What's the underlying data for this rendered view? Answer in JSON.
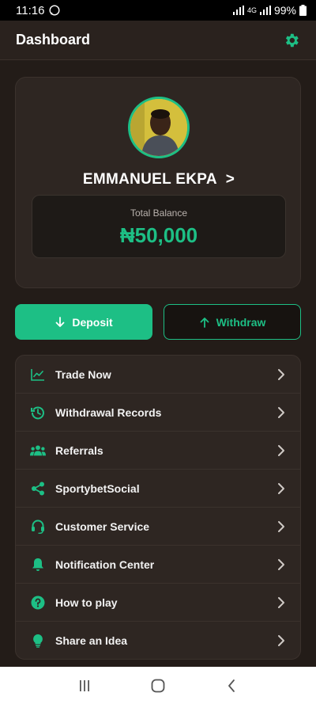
{
  "status_bar": {
    "time": "11:16",
    "network": "4G",
    "battery": "99%"
  },
  "header": {
    "title": "Dashboard"
  },
  "profile": {
    "name": "EMMANUEL EKPA",
    "arrow": ">",
    "balance_label": "Total Balance",
    "balance_amount": "₦50,000"
  },
  "actions": {
    "deposit_label": "Deposit",
    "withdraw_label": "Withdraw"
  },
  "menu": {
    "items": [
      {
        "label": "Trade Now",
        "icon": "chart-line-icon"
      },
      {
        "label": "Withdrawal Records",
        "icon": "history-icon"
      },
      {
        "label": "Referrals",
        "icon": "users-icon"
      },
      {
        "label": "SportybetSocial",
        "icon": "share-icon"
      },
      {
        "label": "Customer Service",
        "icon": "headset-icon"
      },
      {
        "label": "Notification Center",
        "icon": "bell-icon"
      },
      {
        "label": "How to play",
        "icon": "question-icon"
      },
      {
        "label": "Share an Idea",
        "icon": "lightbulb-icon"
      }
    ]
  },
  "colors": {
    "accent": "#1dbf85",
    "background": "#231c18",
    "card": "#2e2622"
  }
}
